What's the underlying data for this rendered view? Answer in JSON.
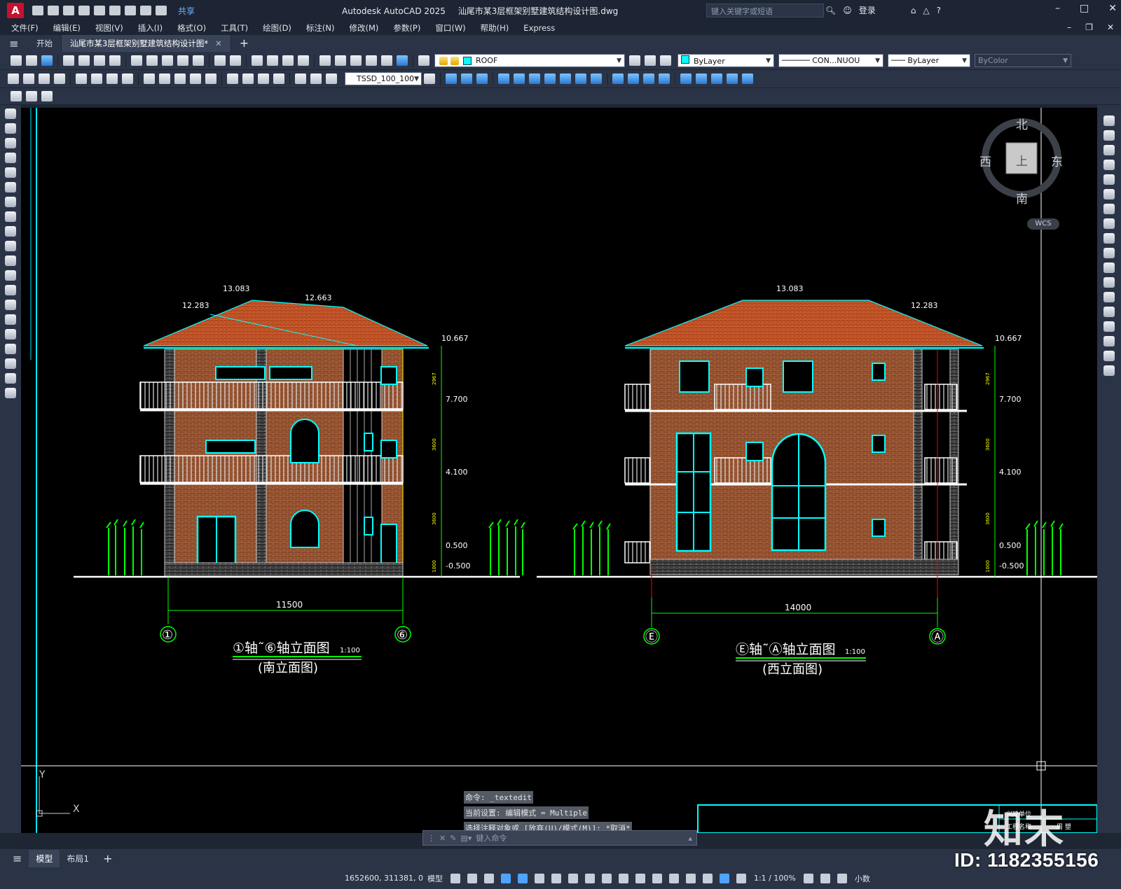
{
  "title_bar": {
    "share_label": "共享",
    "app_name": "Autodesk AutoCAD 2025",
    "file_name": "汕尾市某3层框架别墅建筑结构设计图.dwg",
    "search_placeholder": "键入关键字或短语",
    "login_label": "登录"
  },
  "menu": [
    "文件(F)",
    "编辑(E)",
    "视图(V)",
    "插入(I)",
    "格式(O)",
    "工具(T)",
    "绘图(D)",
    "标注(N)",
    "修改(M)",
    "参数(P)",
    "窗口(W)",
    "帮助(H)",
    "Express"
  ],
  "doc_tabs": {
    "start": "开始",
    "active": "汕尾市某3层框架别墅建筑结构设计图*"
  },
  "properties": {
    "layer": "ROOF",
    "color": "ByLayer",
    "linetype": "CON...NUOU",
    "lineweight": "ByLayer",
    "plotstyle": "ByColor",
    "dimstyle": "TSSD_100_100"
  },
  "colors": {
    "accent": "#00ffff",
    "roof": "#a0401c",
    "brick": "#9c5a36",
    "ground": "#ffffff",
    "dim": "#00ff00"
  },
  "viewcube": {
    "north": "北",
    "south": "南",
    "east": "东",
    "west": "西",
    "top": "上",
    "wcs": "WCS"
  },
  "drawing": {
    "left": {
      "title": "①轴˜⑥轴立面图",
      "scale": "1:100",
      "subtitle": "(南立面图)",
      "width_dim": "11500",
      "axis_left": "①",
      "axis_right": "⑥",
      "elevations": [
        "13.083",
        "12.663",
        "12.283",
        "10.667",
        "7.700",
        "4.100",
        "0.500",
        "-0.500"
      ],
      "segments": [
        "2967",
        "3600",
        "3600",
        "1000"
      ]
    },
    "right": {
      "title": "Ⓔ轴˜Ⓐ轴立面图",
      "scale": "1:100",
      "subtitle": "(西立面图)",
      "width_dim": "14000",
      "axis_left": "Ⓔ",
      "axis_right": "Ⓐ",
      "elevations": [
        "13.083",
        "12.283",
        "10.667",
        "7.700",
        "4.100",
        "0.500",
        "-0.500"
      ],
      "segments": [
        "2967",
        "3600",
        "3600",
        "1000"
      ]
    },
    "title_block": {
      "row1": "兴建单位",
      "row2": "工程名称",
      "row3": "周  塑"
    }
  },
  "command": {
    "history": [
      "命令: _textedit",
      "当前设置: 编辑模式 = Multiple",
      "选择注释对象或 [放弃(U)/模式(M)]: *取消*"
    ],
    "placeholder": "键入命令"
  },
  "layout_tabs": [
    "模型",
    "布局1"
  ],
  "status": {
    "coords": "1652600, 311381, 0",
    "mode": "模型",
    "scale": "1:1 / 100%",
    "units": "小数"
  },
  "watermark": {
    "logo": "知末",
    "id": "ID: 1182355156"
  }
}
